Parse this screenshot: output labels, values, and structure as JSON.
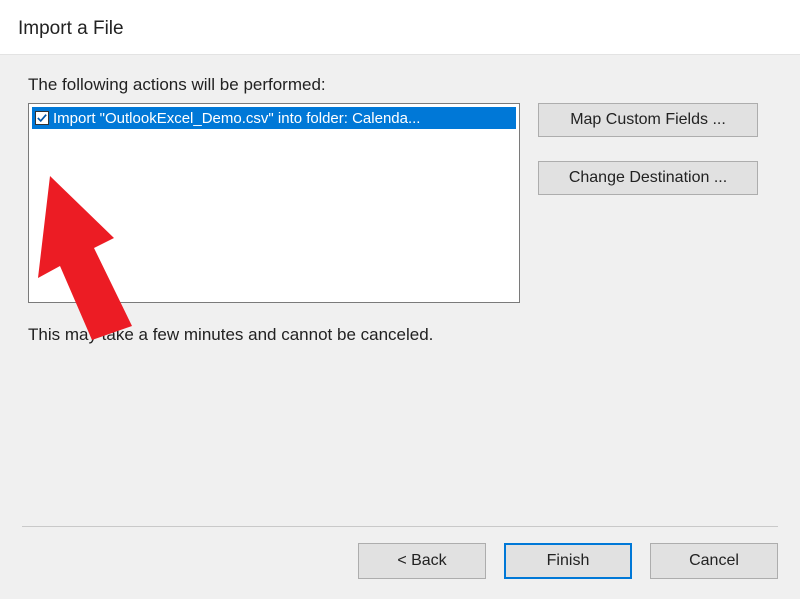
{
  "dialog": {
    "title": "Import a File"
  },
  "content": {
    "actions_label": "The following actions will be performed:",
    "action_item": {
      "checked": true,
      "text": "Import \"OutlookExcel_Demo.csv\" into folder: Calenda..."
    },
    "note": "This may take a few minutes and cannot be canceled."
  },
  "buttons": {
    "map_custom_fields": "Map Custom Fields ...",
    "change_destination": "Change Destination ...",
    "back": "<  Back",
    "finish": "Finish",
    "cancel": "Cancel"
  },
  "colors": {
    "selection": "#0078d7",
    "panel": "#f0f0f0",
    "button": "#e1e1e1",
    "annotation": "#ec1c24"
  }
}
